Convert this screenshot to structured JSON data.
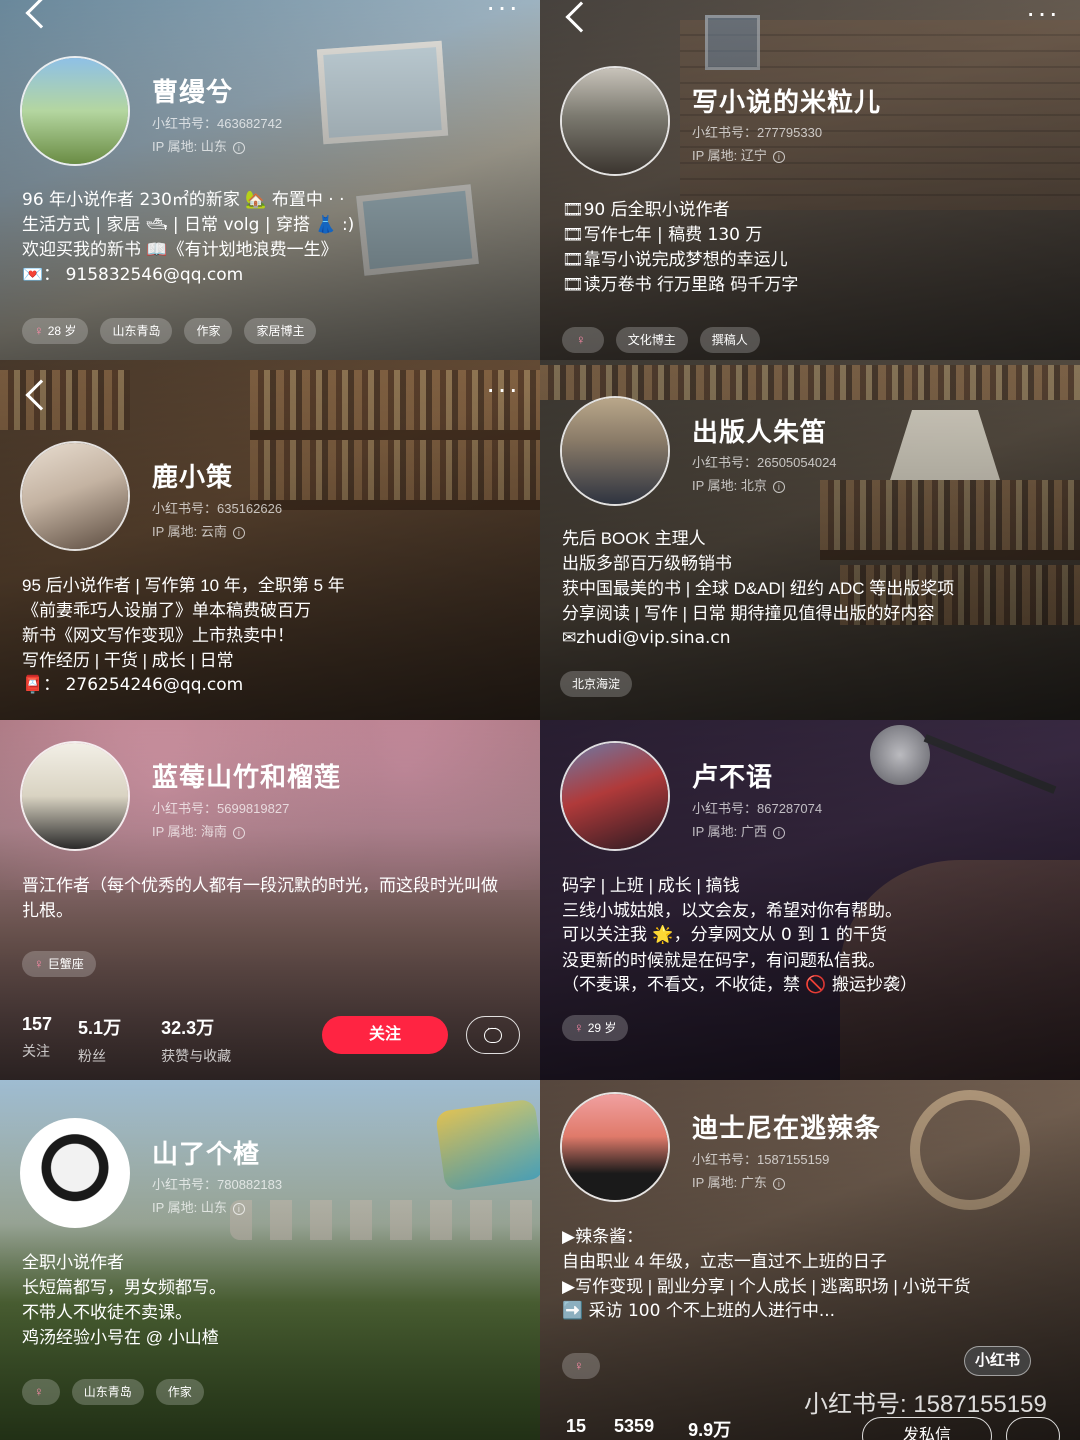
{
  "profiles": [
    {
      "name": "曹缦兮",
      "id_text": "小红书号：463682742",
      "ip_text": "IP 属地: 山东",
      "bio": [
        "96 年小说作者 230㎡的新家 🏡 布置中 · ·",
        "生活方式 | 家居 🛥 | 日常 volg | 穿搭 👗 :)",
        "欢迎买我的新书 📖《有计划地浪费一生》",
        "💌： 915832546@qq.com"
      ],
      "tags": [
        "28 岁",
        "山东青岛",
        "作家",
        "家居博主"
      ]
    },
    {
      "name": "写小说的米粒儿",
      "id_text": "小红书号：277795330",
      "ip_text": "IP 属地: 辽宁",
      "bio": [
        "🎞90 后全职小说作者",
        "🎞写作七年 | 稿费 130 万",
        "🎞靠写小说完成梦想的幸运儿",
        "🎞读万卷书 行万里路 码千万字"
      ],
      "tags": [
        "",
        "文化博主",
        "撰稿人"
      ]
    },
    {
      "name": "鹿小策",
      "id_text": "小红书号：635162626",
      "ip_text": "IP 属地: 云南",
      "bio": [
        "95 后小说作者 | 写作第 10 年，全职第 5 年",
        "《前妻乖巧人设崩了》单本稿费破百万",
        "新书《网文写作变现》上市热卖中！",
        "写作经历 | 干货 | 成长 | 日常",
        "📮： 276254246@qq.com"
      ]
    },
    {
      "name": "出版人朱笛",
      "id_text": "小红书号：26505054024",
      "ip_text": "IP 属地: 北京",
      "bio": [
        "先后 BOOK 主理人",
        "出版多部百万级畅销书",
        "获中国最美的书 | 全球 D&AD| 纽约 ADC 等出版奖项",
        "分享阅读 | 写作 | 日常 期待撞见值得出版的好内容",
        "✉zhudi@vip.sina.cn"
      ],
      "tags": [
        "北京海淀"
      ]
    },
    {
      "name": "蓝莓山竹和榴莲",
      "id_text": "小红书号：5699819827",
      "ip_text": "IP 属地: 海南",
      "bio": [
        "晋江作者（每个优秀的人都有一段沉默的时光，而这段时光叫做",
        "扎根。"
      ],
      "tags": [
        "巨蟹座"
      ],
      "stats": [
        {
          "num": "157",
          "label": "关注"
        },
        {
          "num": "5.1万",
          "label": "粉丝"
        },
        {
          "num": "32.3万",
          "label": "获赞与收藏"
        }
      ],
      "follow_label": "关注"
    },
    {
      "name": "卢不语",
      "id_text": "小红书号：867287074",
      "ip_text": "IP 属地: 广西",
      "bio": [
        "码字 | 上班 | 成长 | 搞钱",
        "三线小城姑娘，以文会友，希望对你有帮助。",
        "可以关注我 🌟，分享网文从 0 到 1 的干货",
        "没更新的时候就是在码字，有问题私信我。",
        "（不麦课，不看文，不收徒，禁 🚫 搬运抄袭）"
      ],
      "tags": [
        "29 岁"
      ]
    },
    {
      "name": "山了个楂",
      "id_text": "小红书号：780882183",
      "ip_text": "IP 属地: 山东",
      "bio": [
        "全职小说作者",
        "长短篇都写，男女频都写。",
        "不带人不收徒不卖课。",
        "鸡汤经验小号在 @ 小山楂"
      ],
      "tags": [
        "",
        "山东青岛",
        "作家"
      ]
    },
    {
      "name": "迪士尼在逃辣条",
      "id_text": "小红书号：1587155159",
      "ip_text": "IP 属地: 广东",
      "bio": [
        "▶辣条酱：",
        "自由职业 4 年级，立志一直过不上班的日子",
        "▶写作变现 | 副业分享 | 个人成长 | 逃离职场 | 小说干货",
        "➡️ 采访 100 个不上班的人进行中..."
      ],
      "tags": [
        ""
      ],
      "stats": [
        {
          "num": "15"
        },
        {
          "num": "5359"
        },
        {
          "num": "9.9万"
        }
      ],
      "dm_label": "发私信",
      "watermark_badge": "小红书",
      "watermark_text": "小红书号: 1587155159"
    }
  ],
  "icons": {
    "back": "back-chevron-icon",
    "more": "more-dots-icon",
    "female": "♀",
    "info": "i"
  },
  "colors": {
    "accent": "#ff2442"
  }
}
